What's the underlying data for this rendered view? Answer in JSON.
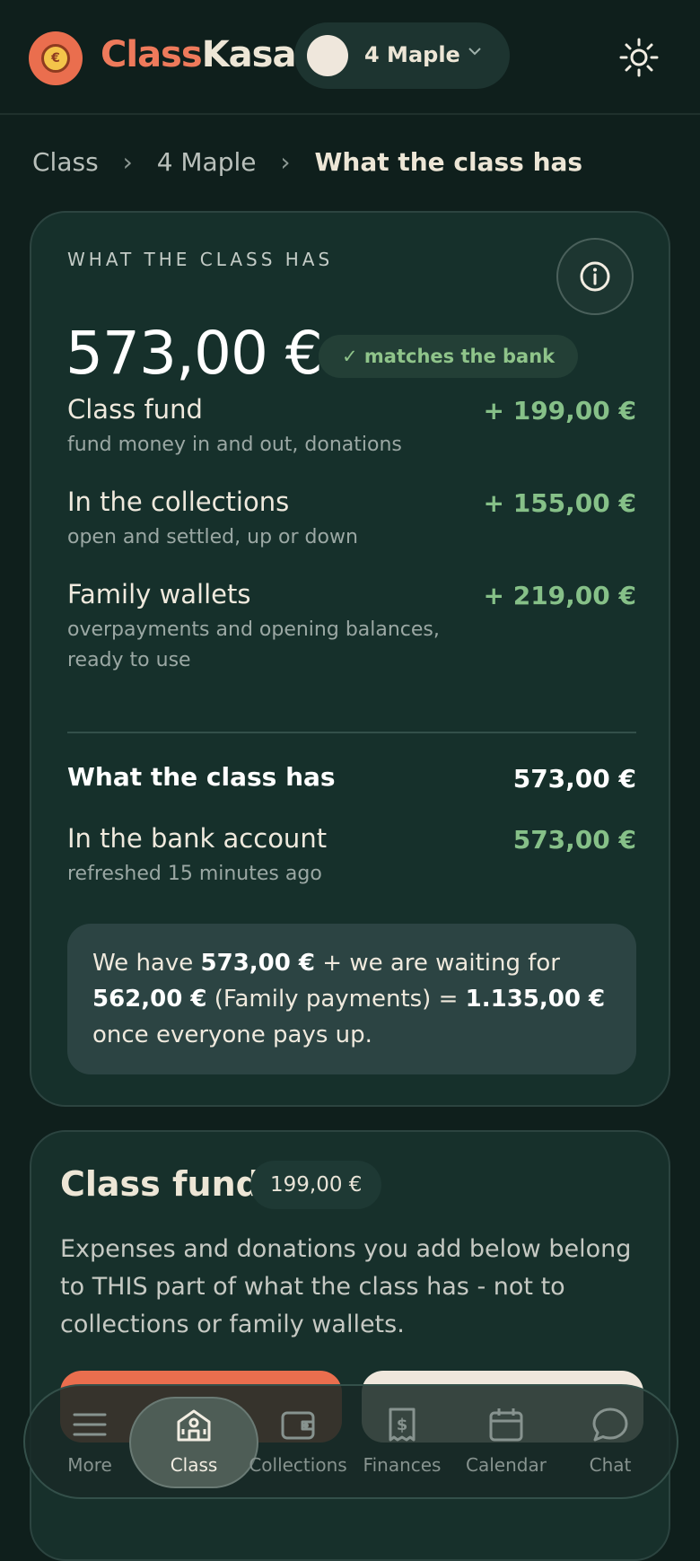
{
  "header": {
    "brand_part1": "Class",
    "brand_part2": "Kasa",
    "class_selector": "4 Maple",
    "colors": {
      "accent": "#ee7a5b",
      "positive": "#86c088",
      "background": "#0f1f1c"
    }
  },
  "breadcrumb": [
    "Class",
    "4 Maple",
    "What the class has"
  ],
  "summary": {
    "kicker": "WHAT THE CLASS HAS",
    "total": "573,00 €",
    "match_badge": "✓ matches the bank",
    "rows": [
      {
        "name": "Class fund",
        "sub": "fund money in and out, donations",
        "amount": "+ 199,00 €"
      },
      {
        "name": "In the collections",
        "sub": "open and settled, up or down",
        "amount": "+ 155,00 €"
      },
      {
        "name": "Family wallets",
        "sub": "overpayments and opening balances, ready to use",
        "amount": "+ 219,00 €"
      }
    ],
    "what_has_label": "What the class has",
    "what_has_amount": "573,00 €",
    "bank_label": "In the bank account",
    "bank_sub": "refreshed 15 minutes ago",
    "bank_amount": "573,00 €",
    "note": {
      "p1": "We have ",
      "b1": "573,00 €",
      "p2": " + we are waiting for ",
      "b2": "562,00 €",
      "p3": " (Family payments) = ",
      "b3": "1.135,00 €",
      "p4": " once everyone pays up."
    }
  },
  "class_fund": {
    "title": "Class fund",
    "amount": "199,00 €",
    "description": "Expenses and donations you add below belong to THIS part of what the class has - not to collections or family wallets."
  },
  "nav": [
    {
      "label": "More",
      "icon": "menu-icon"
    },
    {
      "label": "Class",
      "icon": "school-icon",
      "active": true
    },
    {
      "label": "Collections",
      "icon": "wallet-icon"
    },
    {
      "label": "Finances",
      "icon": "receipt-icon"
    },
    {
      "label": "Calendar",
      "icon": "calendar-icon"
    },
    {
      "label": "Chat",
      "icon": "chat-icon"
    }
  ]
}
